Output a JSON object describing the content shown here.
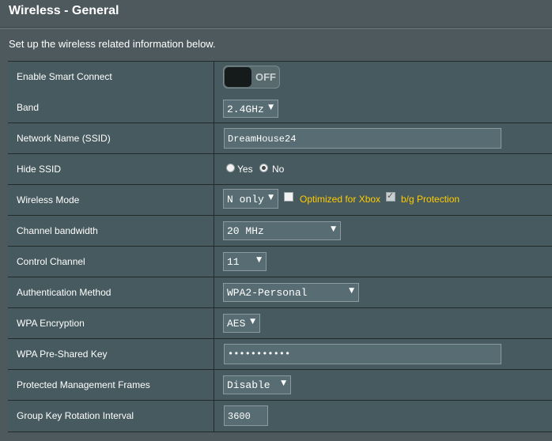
{
  "page": {
    "title": "Wireless - General",
    "description": "Set up the wireless related information below."
  },
  "rows": {
    "smart_connect": {
      "label": "Enable Smart Connect",
      "toggle_text": "OFF"
    },
    "band": {
      "label": "Band",
      "value": "2.4GHz"
    },
    "ssid": {
      "label": "Network Name (SSID)",
      "value": "DreamHouse24"
    },
    "hide_ssid": {
      "label": "Hide SSID",
      "yes": "Yes",
      "no": "No",
      "selected": "No"
    },
    "wireless_mode": {
      "label": "Wireless Mode",
      "value": "N only",
      "xbox": "Optimized for Xbox",
      "bg": "b/g Protection"
    },
    "channel_bandwidth": {
      "label": "Channel bandwidth",
      "value": "20 MHz"
    },
    "control_channel": {
      "label": "Control Channel",
      "value": "11"
    },
    "auth_method": {
      "label": "Authentication Method",
      "value": "WPA2-Personal"
    },
    "wpa_encryption": {
      "label": "WPA Encryption",
      "value": "AES"
    },
    "psk": {
      "label": "WPA Pre-Shared Key",
      "value": "•••••••••••"
    },
    "pmf": {
      "label": "Protected Management Frames",
      "value": "Disable"
    },
    "gkri": {
      "label": "Group Key Rotation Interval",
      "value": "3600"
    }
  },
  "colors": {
    "accent_label": "#ffcc00",
    "background": "#4d595d",
    "row": "#475a5f"
  }
}
